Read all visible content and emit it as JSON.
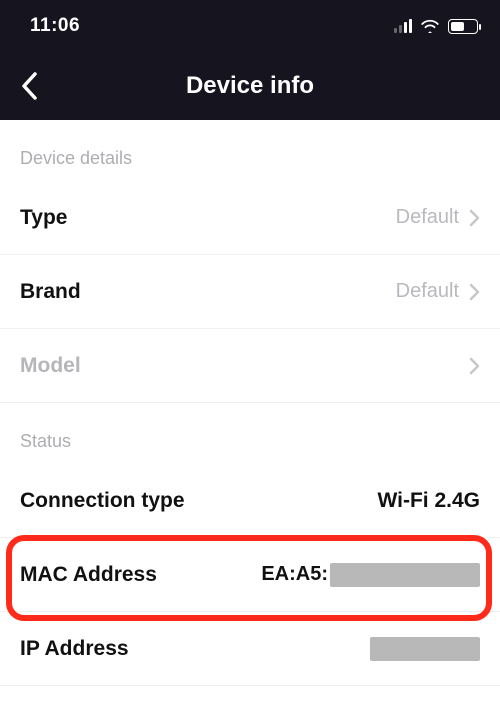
{
  "statusBar": {
    "time": "11:06",
    "batteryPercent": 55
  },
  "nav": {
    "title": "Device info"
  },
  "sections": {
    "details": {
      "header": "Device details",
      "type": {
        "label": "Type",
        "value": "Default"
      },
      "brand": {
        "label": "Brand",
        "value": "Default"
      },
      "model": {
        "label": "Model",
        "value": ""
      }
    },
    "status": {
      "header": "Status",
      "connection": {
        "label": "Connection type",
        "value": "Wi-Fi 2.4G"
      },
      "mac": {
        "label": "MAC Address",
        "valuePrefix": "EA:A5:"
      },
      "ip": {
        "label": "IP Address"
      }
    }
  }
}
